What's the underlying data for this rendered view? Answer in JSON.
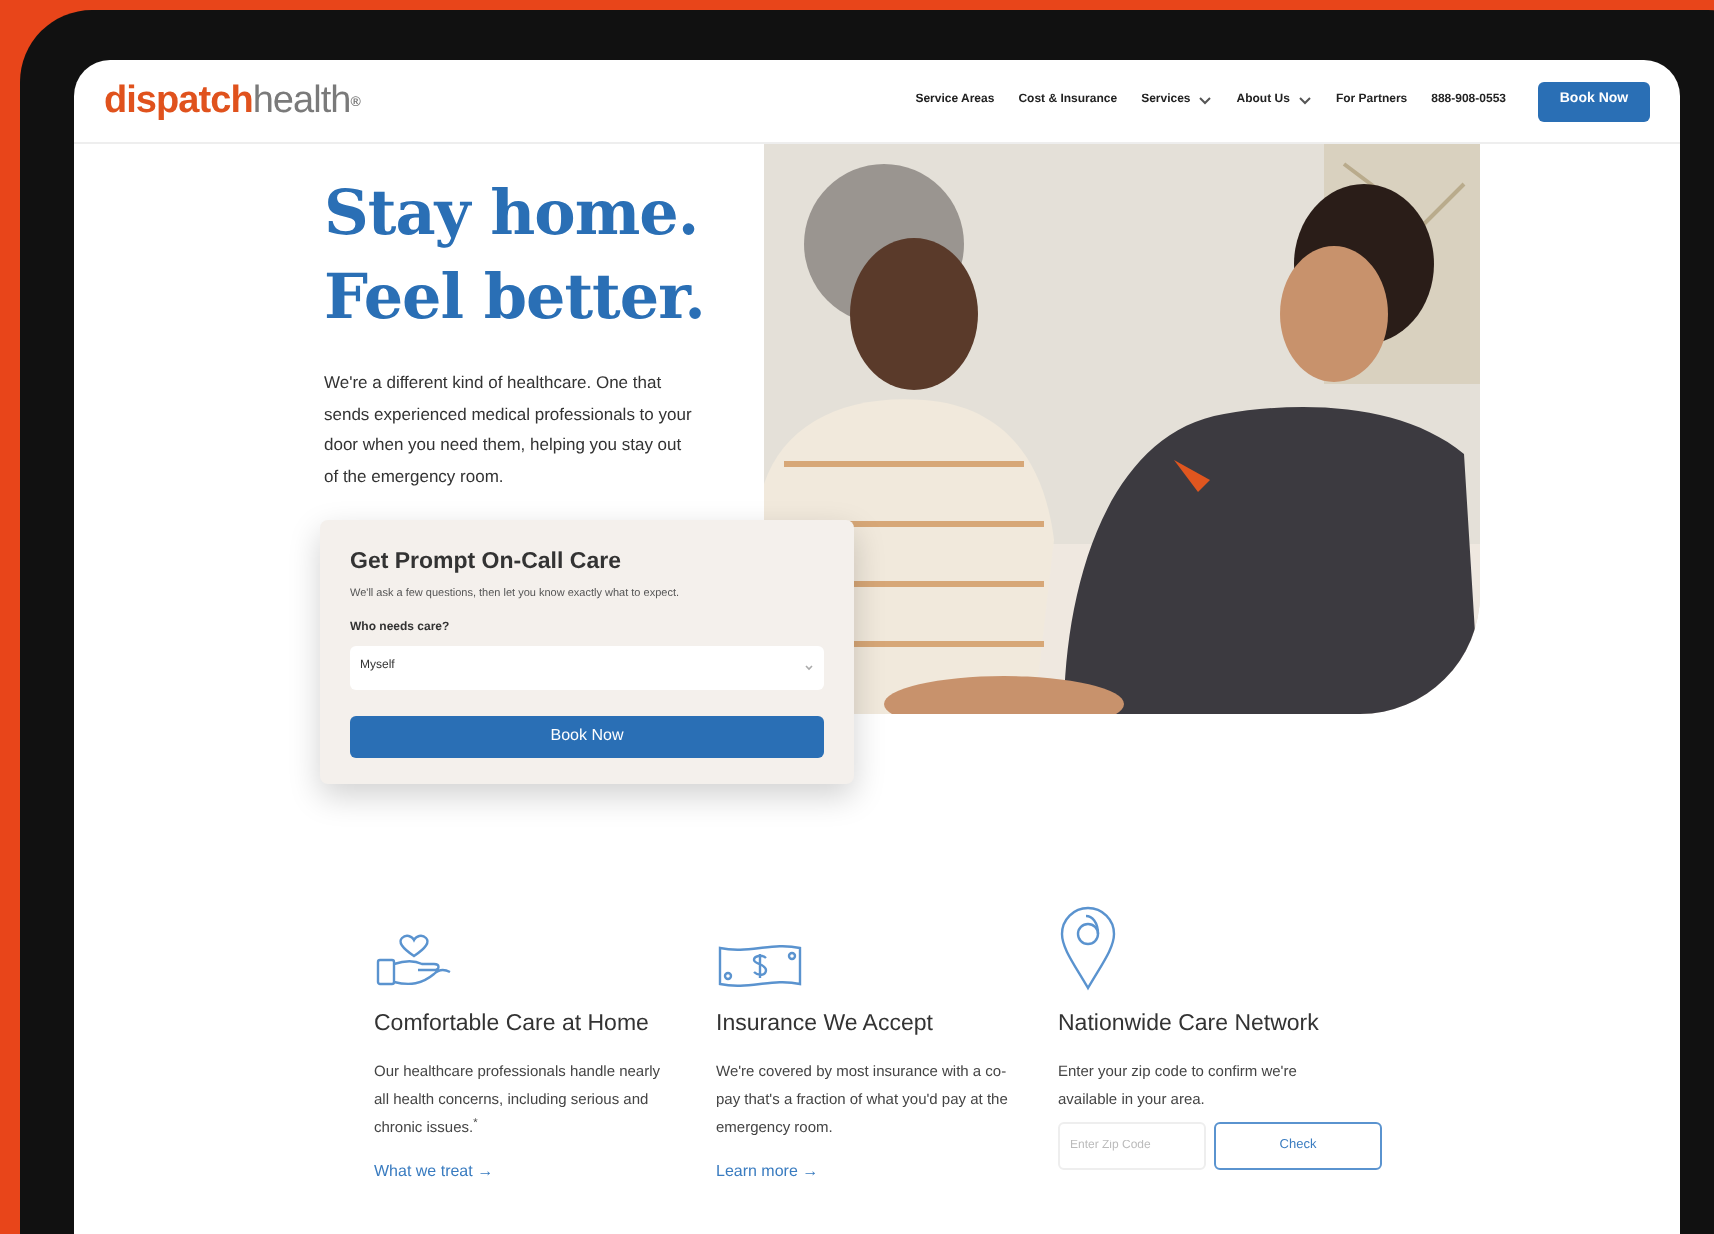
{
  "header": {
    "logo": {
      "primary": "dispatch",
      "secondary": "health",
      "mark": "®"
    },
    "nav": [
      {
        "label": "Service Areas",
        "dropdown": false
      },
      {
        "label": "Cost & Insurance",
        "dropdown": false
      },
      {
        "label": "Services",
        "dropdown": true
      },
      {
        "label": "About Us",
        "dropdown": true
      },
      {
        "label": "For Partners",
        "dropdown": false
      },
      {
        "label": "888-908-0553",
        "dropdown": false
      }
    ],
    "button": "Book Now"
  },
  "hero": {
    "title_lines": [
      "Stay home.",
      "Feel better."
    ],
    "text": "We're a different kind of healthcare. One that sends experienced medical professionals to your door when you need them, helping you stay out of the emergency room.",
    "card": {
      "title": "Get Prompt On-Call Care",
      "subtitle": "We'll ask a few questions, then let you know exactly what to expect.",
      "field_label": "Who needs care?",
      "select_value": "Myself",
      "button": "Book Now"
    },
    "photo": {
      "kind": "picture"
    }
  },
  "features": [
    {
      "kind": "link",
      "title": "Comfortable Care at Home",
      "text": "Our healthcare professionals handle nearly all health concerns, including serious and chronic issues.$^{*}$",
      "link": "What we treat →"
    },
    {
      "kind": "link",
      "title": "Insurance We Accept",
      "text": "We're covered by most insurance with a co-pay that's a fraction of what you'd pay at the emergency room.",
      "link": "Learn more →"
    },
    {
      "kind": "zip",
      "title": "Nationwide Care Network",
      "text": "Enter your zip code to confirm we're available in your area.",
      "placeholder": "Enter Zip Code",
      "button": "Check"
    }
  ]
}
